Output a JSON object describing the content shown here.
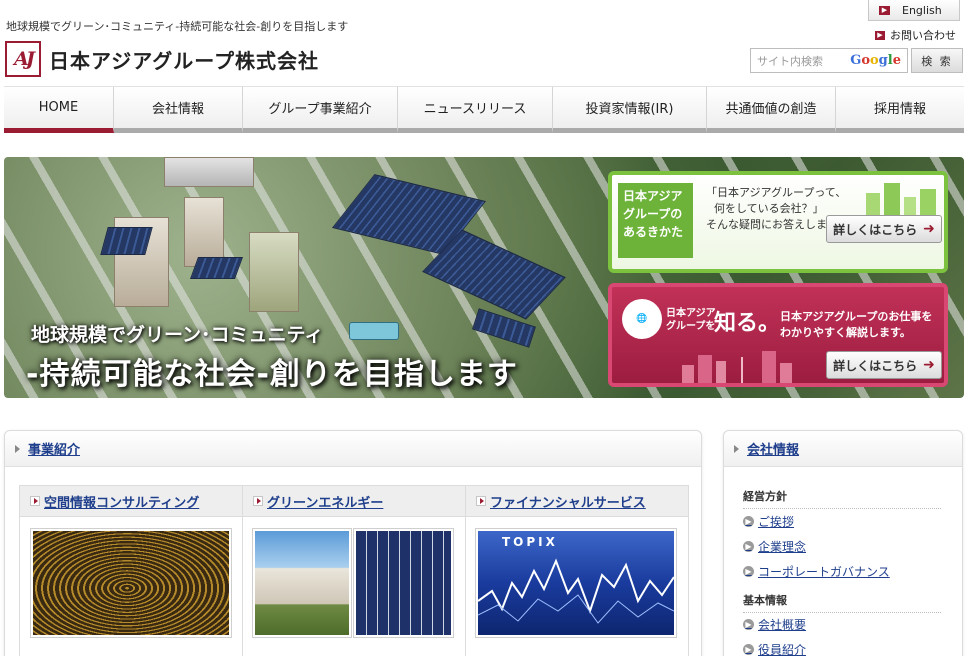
{
  "header": {
    "tagline": "地球規模でグリーン･コミュニティ-持続可能な社会-創りを目指します",
    "logo_mark": "AJ",
    "company_name": "日本アジアグループ株式会社",
    "lang_link": "English",
    "contact_link": "お問い合わせ",
    "search_placeholder": "サイト内検索",
    "search_brand": "Google",
    "search_button": "検 索"
  },
  "nav": {
    "items": [
      {
        "label": "HOME",
        "active": true
      },
      {
        "label": "会社情報"
      },
      {
        "label": "グループ事業紹介"
      },
      {
        "label": "ニュースリリース"
      },
      {
        "label": "投資家情報(IR)"
      },
      {
        "label": "共通価値の創造"
      },
      {
        "label": "採用情報"
      }
    ]
  },
  "hero": {
    "line1": "地球規模でグリーン･コミュニティ",
    "line2": "-持続可能な社会-創りを目指します",
    "card_green": {
      "badge": [
        "日本アジア",
        "グループの",
        "あるきかた"
      ],
      "msg": [
        "「日本アジアグループって、",
        "何をしている会社？」",
        "そんな疑問にお答えします。"
      ],
      "button": "詳しくはこちら"
    },
    "card_red": {
      "circle_label": "日本アジア",
      "small_label": [
        "日本アジア",
        "グループを"
      ],
      "big_label": "知る。",
      "msg": [
        "日本アジアグループのお仕事を",
        "わかりやすく解説します。"
      ],
      "button": "詳しくはこちら"
    }
  },
  "business": {
    "title": "事業紹介",
    "columns": [
      {
        "title": "空間情報コンサルティング"
      },
      {
        "title": "グリーンエネルギー"
      },
      {
        "title": "ファイナンシャルサービス"
      }
    ],
    "topix_label": "TOPIX"
  },
  "company_info": {
    "title": "会社情報",
    "groups": [
      {
        "title": "経営方針",
        "links": [
          "ご挨拶",
          "企業理念",
          "コーポレートガバナンス"
        ]
      },
      {
        "title": "基本情報",
        "links": [
          "会社概要",
          "役員紹介"
        ]
      }
    ]
  },
  "colors": {
    "brand": "#9a1b32",
    "link": "#1f3f8c",
    "green_card": "#7cc23e",
    "red_card": "#c23158"
  }
}
